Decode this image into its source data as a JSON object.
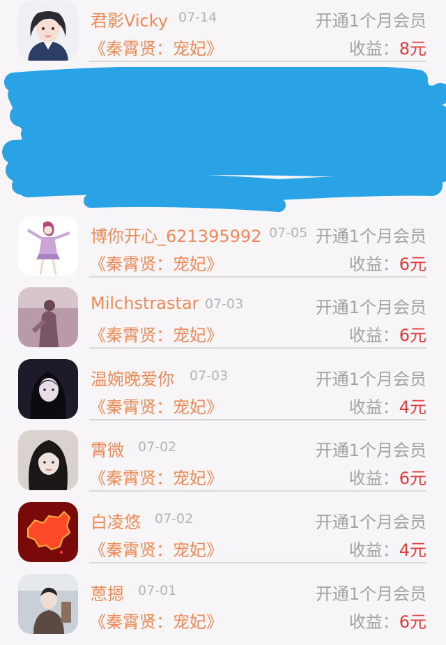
{
  "rows": [
    {
      "name": "君影Vicky",
      "date": "07-14",
      "vip": "开通1个月会员",
      "book": "《秦霄贤：宠妃》",
      "earn_label": "收益：",
      "earn_amount": "8元",
      "avatar": "girl-avatar-icon"
    },
    {
      "name": "",
      "date": "",
      "vip": "",
      "book": "",
      "earn_label": "",
      "earn_amount": "",
      "avatar": "redacted"
    },
    {
      "name": "博你开心_621395992",
      "date": "07-05",
      "vip": "开通1个月会员",
      "book": "《秦霄贤：宠妃》",
      "earn_label": "收益：",
      "earn_amount": "6元",
      "avatar": "anime-figure-avatar-icon"
    },
    {
      "name": "Milchstrastar",
      "date": "07-03",
      "vip": "开通1个月会员",
      "book": "《秦霄贤：宠妃》",
      "earn_label": "收益：",
      "earn_amount": "6元",
      "avatar": "photo-avatar-icon"
    },
    {
      "name": "温婉晚爱你",
      "date": "07-03",
      "vip": "开通1个月会员",
      "book": "《秦霄贤：宠妃》",
      "earn_label": "收益：",
      "earn_amount": "4元",
      "avatar": "photo-avatar-icon"
    },
    {
      "name": "霄微",
      "date": "07-02",
      "vip": "开通1个月会员",
      "book": "《秦霄贤：宠妃》",
      "earn_label": "收益：",
      "earn_amount": "6元",
      "avatar": "photo-avatar-icon"
    },
    {
      "name": "白凌悠",
      "date": "07-02",
      "vip": "开通1个月会员",
      "book": "《秦霄贤：宠妃》",
      "earn_label": "收益：",
      "earn_amount": "4元",
      "avatar": "map-avatar-icon"
    },
    {
      "name": "蒽摁",
      "date": "07-01",
      "vip": "开通1个月会员",
      "book": "《秦霄贤：宠妃》",
      "earn_label": "收益：",
      "earn_amount": "6元",
      "avatar": "photo-avatar-icon"
    }
  ],
  "colors": {
    "name": "#ee8a55",
    "book": "#ee8a55",
    "meta": "#a3a3a3",
    "amount": "#dc3c3c",
    "redaction": "#29a3e6",
    "background": "#f7f5f7"
  }
}
